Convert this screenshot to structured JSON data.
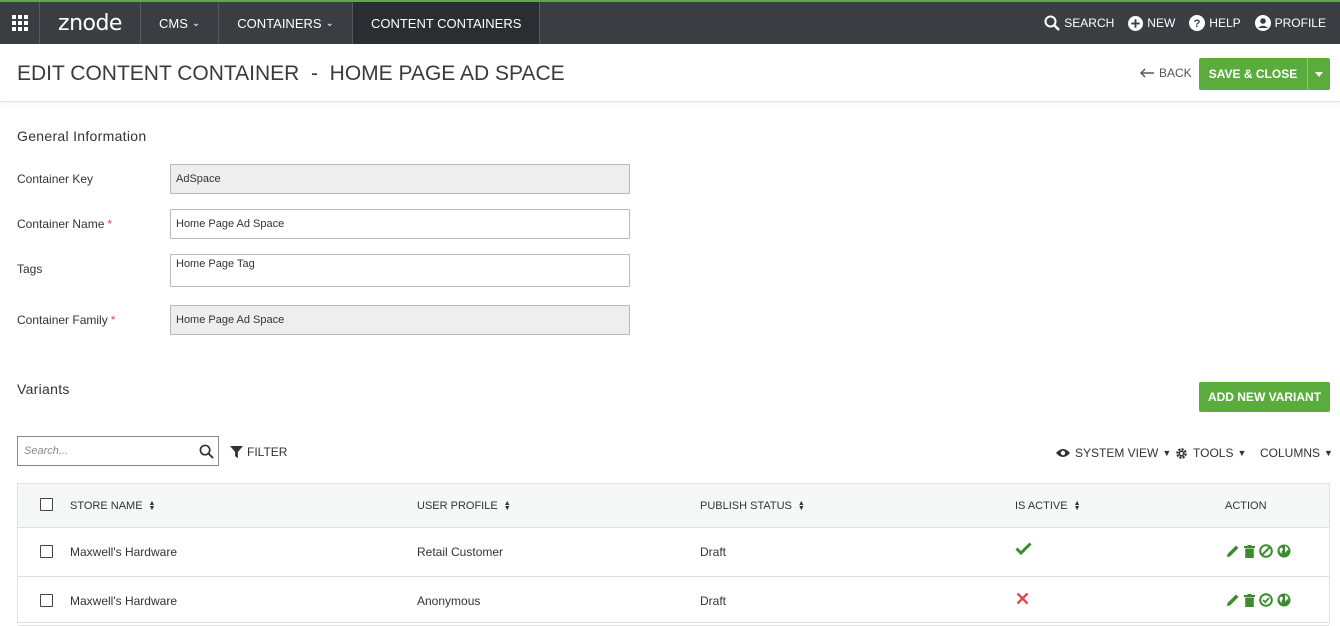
{
  "nav": {
    "logo": "znode",
    "items": [
      {
        "label": "CMS",
        "has_dropdown": true
      },
      {
        "label": "CONTAINERS",
        "has_dropdown": true
      },
      {
        "label": "CONTENT CONTAINERS",
        "active": true
      }
    ],
    "right": {
      "search": "SEARCH",
      "new": "NEW",
      "help": "HELP",
      "profile": "PROFILE"
    }
  },
  "header": {
    "title": "EDIT CONTENT CONTAINER  -  HOME PAGE AD SPACE",
    "back_label": "BACK",
    "save_label": "SAVE & CLOSE"
  },
  "general": {
    "section_title": "General Information",
    "fields": {
      "container_key": {
        "label": "Container Key",
        "value": "AdSpace",
        "readonly": true
      },
      "container_name": {
        "label": "Container Name",
        "required": "*",
        "value": "Home Page Ad Space"
      },
      "tags": {
        "label": "Tags",
        "value": "Home Page Tag"
      },
      "container_family": {
        "label": "Container Family",
        "required": "*",
        "value": "Home Page Ad Space",
        "readonly": true
      }
    }
  },
  "variants": {
    "section_title": "Variants",
    "add_button": "ADD NEW VARIANT",
    "search_placeholder": "Search...",
    "filter_label": "FILTER",
    "system_view_label": "SYSTEM VIEW",
    "tools_label": "TOOLS",
    "columns_label": "COLUMNS",
    "columns": [
      "STORE NAME",
      "USER PROFILE",
      "PUBLISH STATUS",
      "IS ACTIVE",
      "ACTION"
    ],
    "rows": [
      {
        "store_name": "Maxwell's Hardware",
        "user_profile": "Retail Customer",
        "publish_status": "Draft",
        "is_active": true,
        "toggle_icon": "disable-icon"
      },
      {
        "store_name": "Maxwell's Hardware",
        "user_profile": "Anonymous",
        "publish_status": "Draft",
        "is_active": false,
        "toggle_icon": "enable-icon"
      }
    ]
  },
  "colors": {
    "accent_green": "#5aad3c",
    "topbar": "#3a3e43",
    "active_check": "#3d8b2f",
    "inactive_x": "#e0484d",
    "action_icon": "#3d8b2f"
  }
}
